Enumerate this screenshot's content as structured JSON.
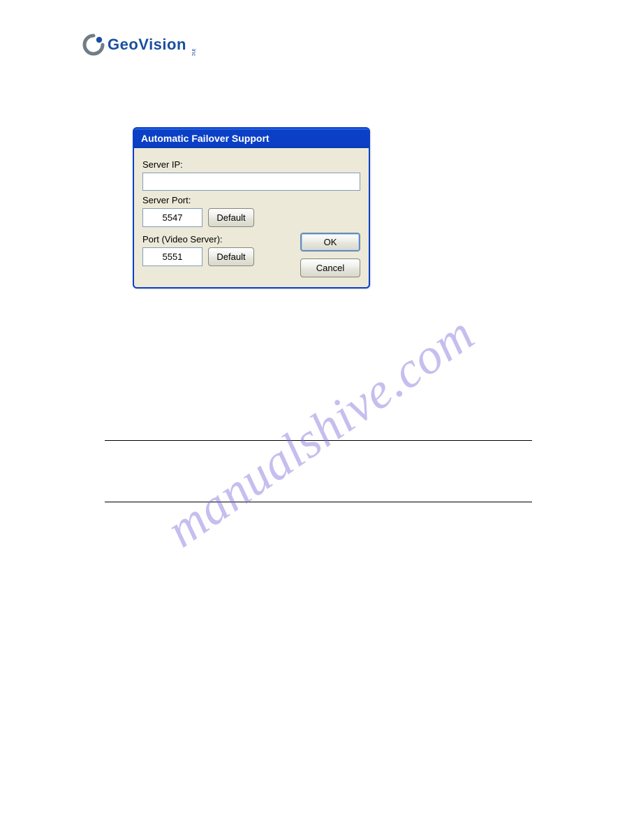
{
  "logo": {
    "geo": "Geo",
    "vision": "Vision",
    "inc": "inc"
  },
  "dialog": {
    "title": "Automatic Failover Support",
    "server_ip_label": "Server IP:",
    "server_ip_value": "",
    "server_port_label": "Server Port:",
    "server_port_value": "5547",
    "video_port_label": "Port (Video Server):",
    "video_port_value": "5551",
    "default_label": "Default",
    "ok_label": "OK",
    "cancel_label": "Cancel"
  },
  "watermark": "manualshive.com"
}
